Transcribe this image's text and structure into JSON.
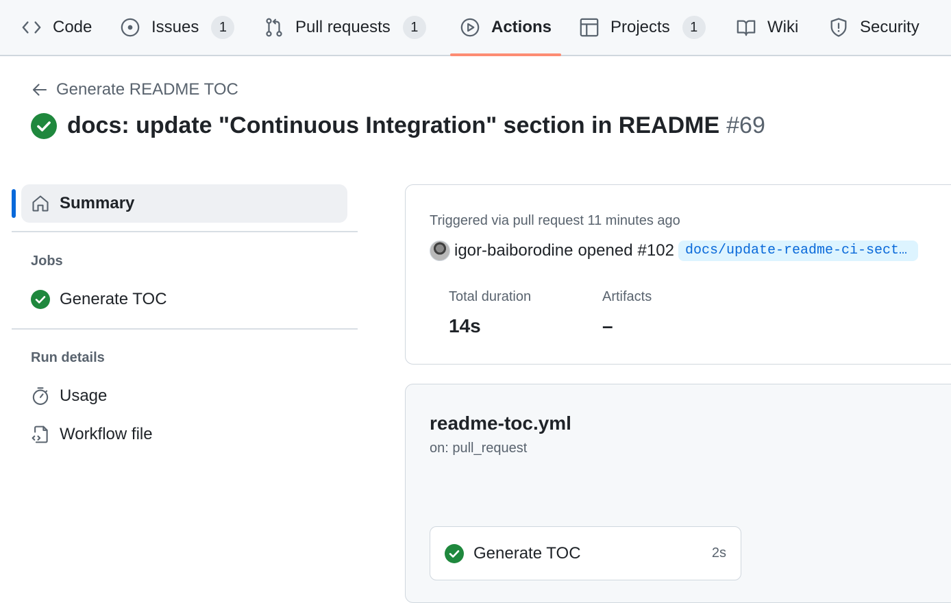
{
  "repo_nav": {
    "tabs": [
      {
        "label": "Code",
        "icon": "code-icon",
        "counter": null
      },
      {
        "label": "Issues",
        "icon": "issue-opened-icon",
        "counter": "1"
      },
      {
        "label": "Pull requests",
        "icon": "git-pull-request-icon",
        "counter": "1"
      },
      {
        "label": "Actions",
        "icon": "play-icon",
        "counter": null,
        "active": true
      },
      {
        "label": "Projects",
        "icon": "table-icon",
        "counter": "1"
      },
      {
        "label": "Wiki",
        "icon": "book-icon",
        "counter": null
      },
      {
        "label": "Security",
        "icon": "shield-icon",
        "counter": null
      }
    ]
  },
  "header": {
    "back_label": "Generate README TOC",
    "run_title": "docs: update \"Continuous Integration\" section in README",
    "run_number": "#69",
    "status_icon": "check-circle-fill-icon",
    "status_color": "#1f883d"
  },
  "sidebar": {
    "summary_label": "Summary",
    "jobs_heading": "Jobs",
    "jobs": [
      {
        "label": "Generate TOC",
        "status_icon": "check-circle-fill-icon"
      }
    ],
    "run_details_heading": "Run details",
    "run_details": [
      {
        "label": "Usage",
        "icon": "stopwatch-icon"
      },
      {
        "label": "Workflow file",
        "icon": "file-code-icon"
      }
    ],
    "accent_color": "#0969da"
  },
  "summary_card": {
    "trigger_text": "Triggered via pull request 11 minutes ago",
    "actor": "igor-baiborodine",
    "action_text": "opened",
    "pr_number": "#102",
    "branch": "docs/update-readme-ci-section",
    "total_duration_label": "Total duration",
    "total_duration_value": "14s",
    "artifacts_label": "Artifacts",
    "artifacts_value": "–"
  },
  "workflow_graph": {
    "file_name": "readme-toc.yml",
    "trigger": "on: pull_request",
    "jobs": [
      {
        "label": "Generate TOC",
        "duration": "2s",
        "status_icon": "check-circle-fill-icon"
      }
    ]
  }
}
